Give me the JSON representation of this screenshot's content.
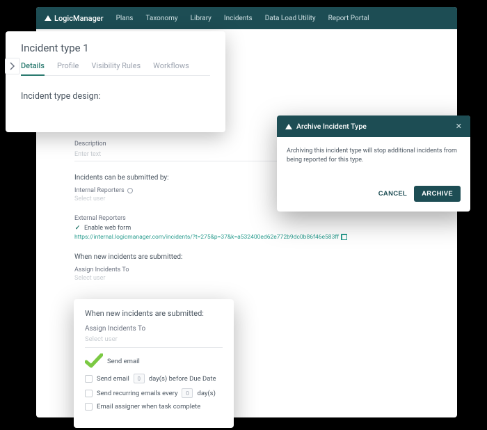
{
  "topbar": {
    "brand": "LogicManager",
    "nav": [
      "Plans",
      "Taxonomy",
      "Library",
      "Incidents",
      "Data Load Utility",
      "Report Portal"
    ]
  },
  "top_card": {
    "title": "Incident type 1",
    "tabs": [
      {
        "label": "Details",
        "active": true
      },
      {
        "label": "Profile",
        "active": false
      },
      {
        "label": "Visibility Rules",
        "active": false
      },
      {
        "label": "Workflows",
        "active": false
      }
    ],
    "design_label": "Incident type design:"
  },
  "main_form": {
    "description_label": "Description",
    "description_placeholder": "Enter text",
    "submitted_by_title": "Incidents can be submitted by:",
    "internal_reporters_label": "Internal Reporters",
    "select_user_placeholder": "Select user",
    "external_reporters_label": "External Reporters",
    "enable_web_form_label": "Enable web form",
    "url": "https://internal.logicmanager.com/incidents/?t=275&p=37&k=a532400ed62e772b9dc0b86f46e583ff",
    "new_incidents_title": "When new incidents are submitted:",
    "assign_to_label": "Assign Incidents To"
  },
  "bottom_card": {
    "title": "When new incidents are submitted:",
    "assign_label": "Assign Incidents To",
    "select_placeholder": "Select user",
    "send_email": "Send email",
    "before_due_prefix": "Send email",
    "before_due_number": "0",
    "before_due_suffix": "day(s) before Due Date",
    "recurring_prefix": "Send recurring emails every",
    "recurring_number": "0",
    "recurring_suffix": "day(s)",
    "email_assigner": "Email assigner when task complete"
  },
  "modal": {
    "title": "Archive Incident Type",
    "body": "Archiving this incident type will stop additional incidents from being reported for this type.",
    "cancel": "CANCEL",
    "archive": "ARCHIVE"
  }
}
